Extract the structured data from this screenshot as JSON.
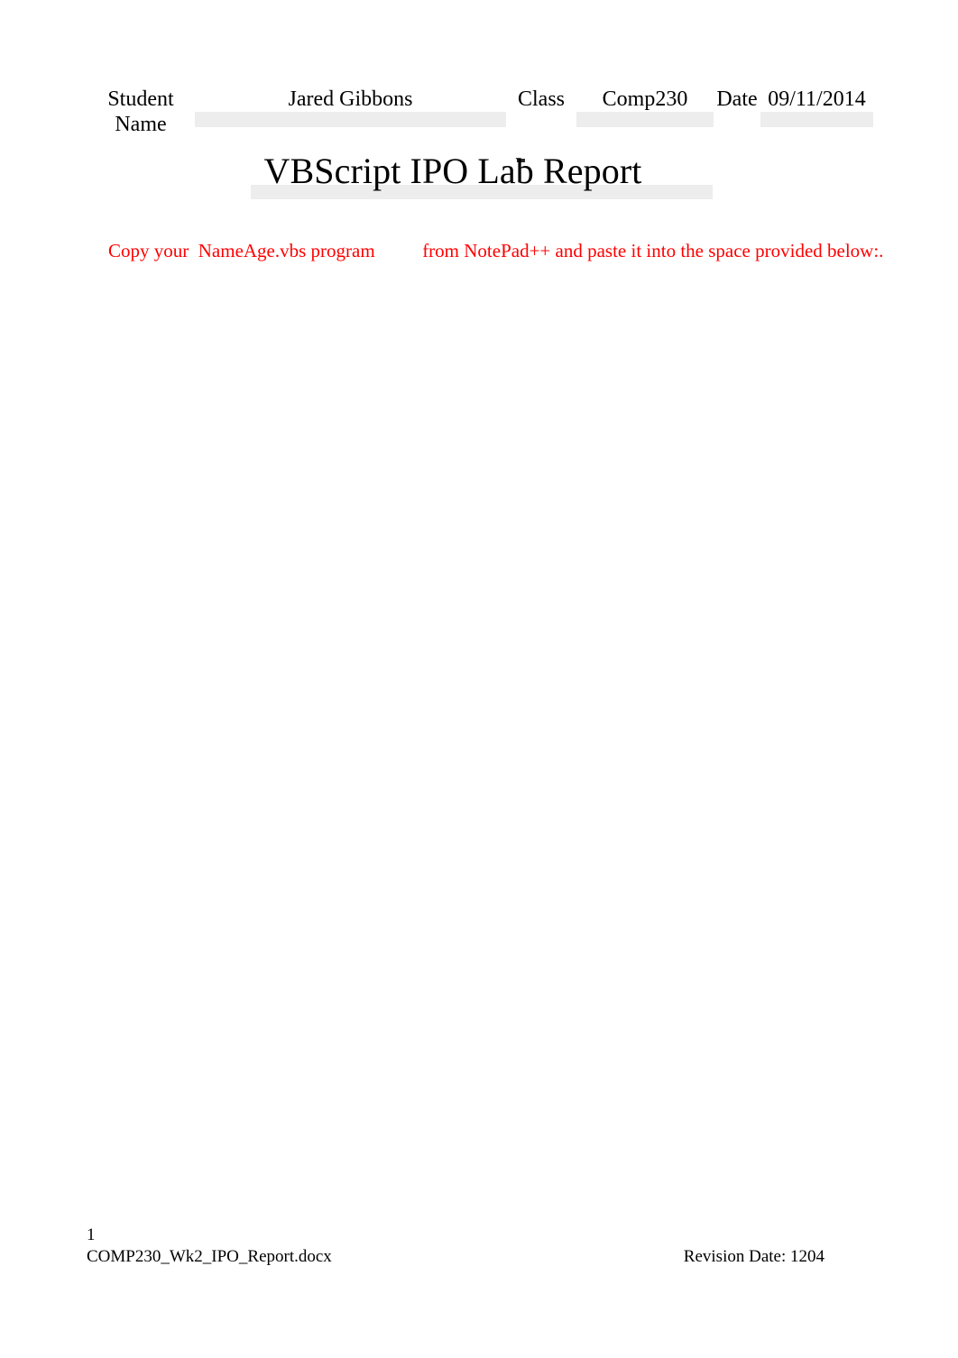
{
  "document": {
    "title": "VBScript IPO Lab Report",
    "page_background": "#ffffff",
    "text_color": "#000000",
    "field_shade_color": "#ededed",
    "instruction_color": "#ff0000"
  },
  "header": {
    "student_name_label": "Student Name",
    "student_name_value": "Jared Gibbons",
    "class_label": "Class",
    "class_value": "Comp230",
    "date_label": "Date",
    "date_value": "09/11/2014"
  },
  "instruction": {
    "part1": "Copy your  NameAge.vbs program",
    "gap": "          ",
    "part2": "from NotePad++ and paste it into the space provided below:.",
    "full_text": "Copy your  NameAge.vbs program          from NotePad++ and paste it into the space provided below:.",
    "color": "#ff0000"
  },
  "body": {
    "content": ""
  },
  "footer": {
    "page_number": "1",
    "filename": "COMP230_Wk2_IPO_Report.docx",
    "revision": "Revision Date: 1204"
  }
}
